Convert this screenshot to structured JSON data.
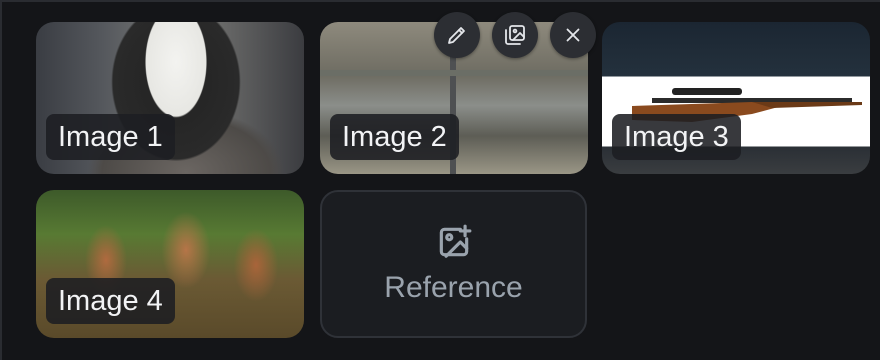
{
  "images": [
    {
      "label": "Image 1"
    },
    {
      "label": "Image 2"
    },
    {
      "label": "Image 3"
    },
    {
      "label": "Image 4"
    }
  ],
  "reference_tile": {
    "label": "Reference",
    "icon": "add-image-icon"
  },
  "toolbar": {
    "icons": [
      "pencil-icon",
      "gallery-icon",
      "close-icon"
    ]
  },
  "colors": {
    "background": "#141518",
    "tile_bg": "#1b1d21",
    "label_text": "#f2f3f5",
    "reference_text": "#9aa3ad"
  }
}
